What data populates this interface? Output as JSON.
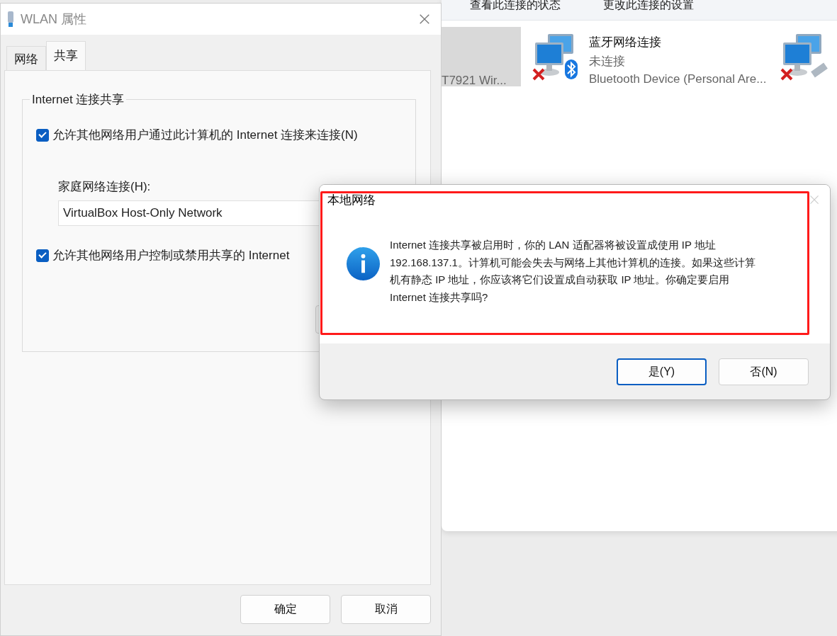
{
  "background_window": {
    "toolbar": [
      "查看此连接的状态",
      "更改此连接的设置"
    ],
    "connections": [
      {
        "kind": "partial",
        "description": "T7921 Wir...",
        "selected": true
      },
      {
        "kind": "bluetooth",
        "name": "蓝牙网络连接",
        "status": "未连接",
        "description": "Bluetooth Device (Personal Are...",
        "selected": false
      },
      {
        "kind": "ethernet",
        "selected": false
      }
    ]
  },
  "properties_window": {
    "title": "WLAN 属性",
    "tabs": [
      {
        "label": "网络",
        "selected": false
      },
      {
        "label": "共享",
        "selected": true
      }
    ],
    "group_title": "Internet 连接共享",
    "options": [
      {
        "kind": "checkbox",
        "label": "允许其他网络用户通过此计算机的 Internet 连接来连接(N)",
        "checked": true
      },
      {
        "kind": "dropdown",
        "label": "家庭网络连接(H):",
        "value": "VirtualBox Host-Only Network"
      },
      {
        "kind": "checkbox",
        "label": "允许其他网络用户控制或禁用共享的 Internet",
        "checked": true
      }
    ],
    "buttons": [
      "确定",
      "取消"
    ]
  },
  "message_dialog": {
    "title": "本地网络",
    "highlighted": true,
    "message": "Internet 连接共享被启用时，你的 LAN 适配器将被设置成使用 IP 地址 192.168.137.1。计算机可能会失去与网络上其他计算机的连接。如果这些计算机有静态 IP 地址，你应该将它们设置成自动获取 IP 地址。你确定要启用 Internet 连接共享吗?",
    "buttons": [
      {
        "label": "是(Y)",
        "selected": true
      },
      {
        "label": "否(N)",
        "selected": false
      }
    ]
  }
}
